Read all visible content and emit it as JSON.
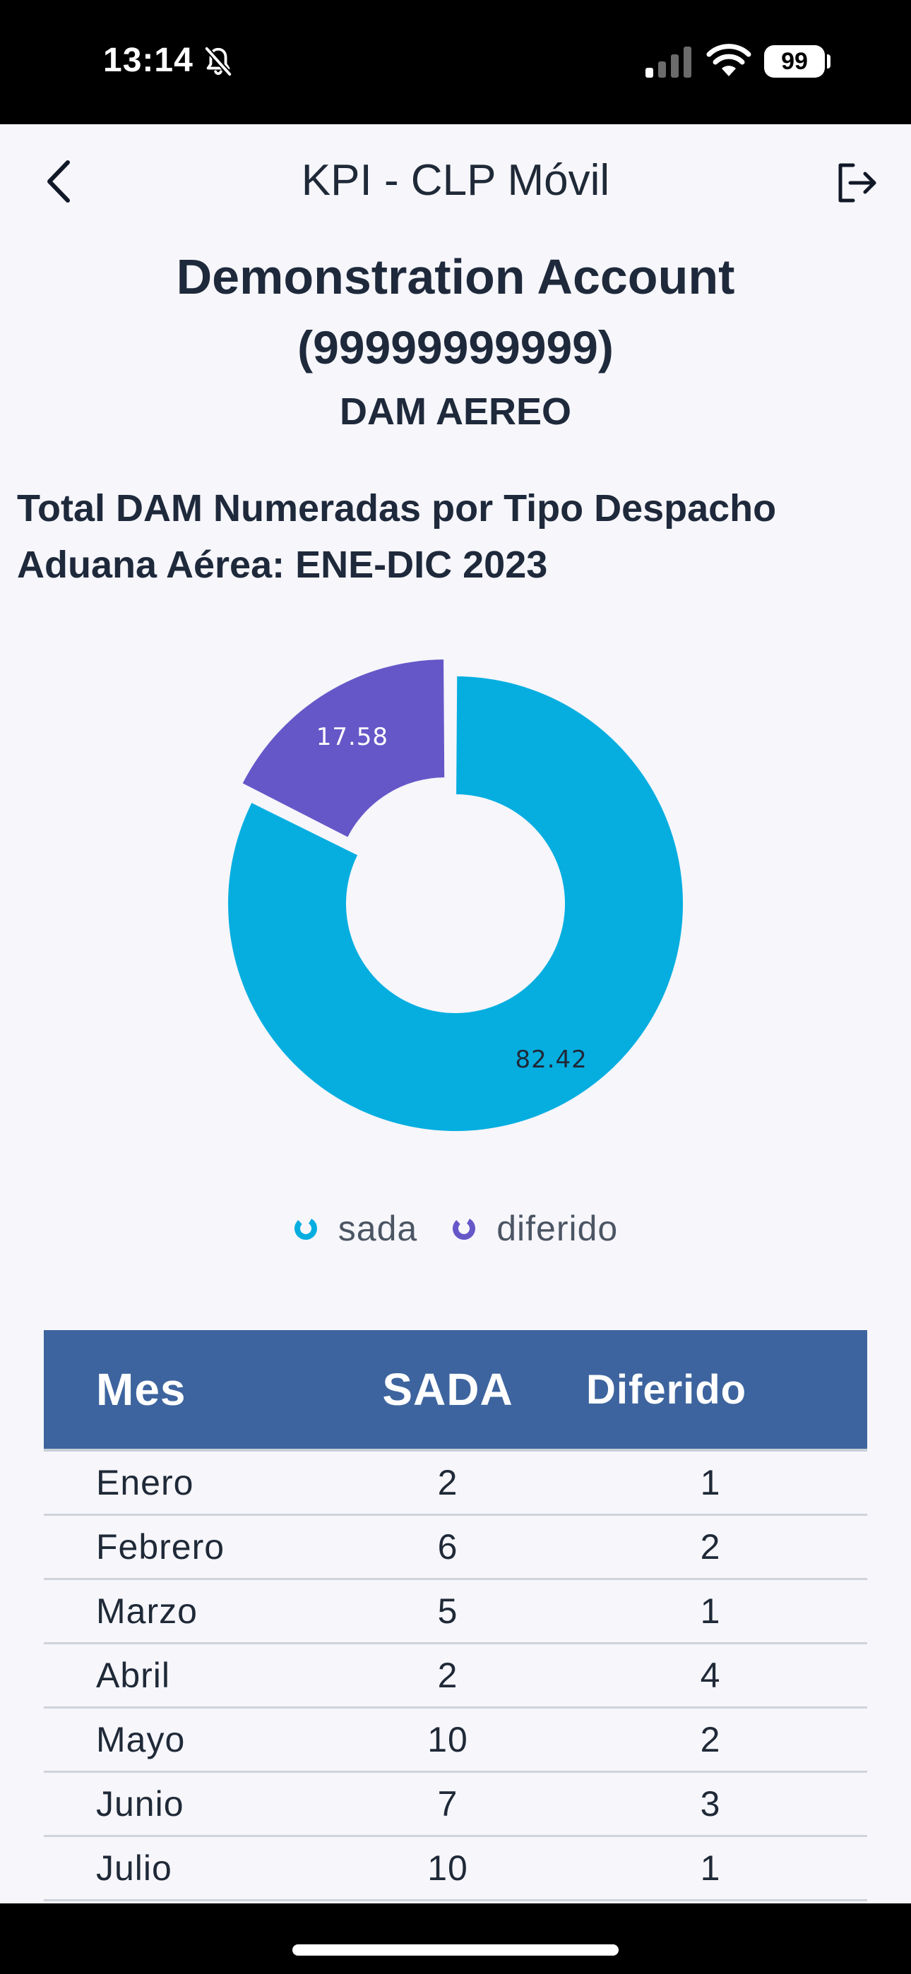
{
  "status_bar": {
    "time": "13:14",
    "battery": "99",
    "icons": [
      "bell-slash-icon",
      "signal-icon",
      "wifi-icon",
      "battery-icon"
    ]
  },
  "nav": {
    "title": "KPI - CLP Móvil",
    "back_icon": "chevron-left-icon",
    "logout_icon": "logout-icon"
  },
  "account": {
    "name": "Demonstration Account",
    "id": "(99999999999)",
    "type": "DAM AEREO"
  },
  "chart_data": {
    "type": "pie",
    "title": "Total DAM Numeradas por Tipo Despacho Aduana Aérea: ENE-DIC 2023",
    "categories": [
      "sada",
      "diferido"
    ],
    "values": [
      82.42,
      17.58
    ],
    "labels": [
      "82.42",
      "17.58"
    ],
    "colors": [
      "#06aee0",
      "#6657c8"
    ],
    "donut": true,
    "exploded": [
      "diferido"
    ],
    "legend_position": "bottom"
  },
  "table": {
    "headers": [
      "Mes",
      "SADA",
      "Diferido"
    ],
    "rows": [
      [
        "Enero",
        "2",
        "1"
      ],
      [
        "Febrero",
        "6",
        "2"
      ],
      [
        "Marzo",
        "5",
        "1"
      ],
      [
        "Abril",
        "2",
        "4"
      ],
      [
        "Mayo",
        "10",
        "2"
      ],
      [
        "Junio",
        "7",
        "3"
      ],
      [
        "Julio",
        "10",
        "1"
      ]
    ]
  }
}
